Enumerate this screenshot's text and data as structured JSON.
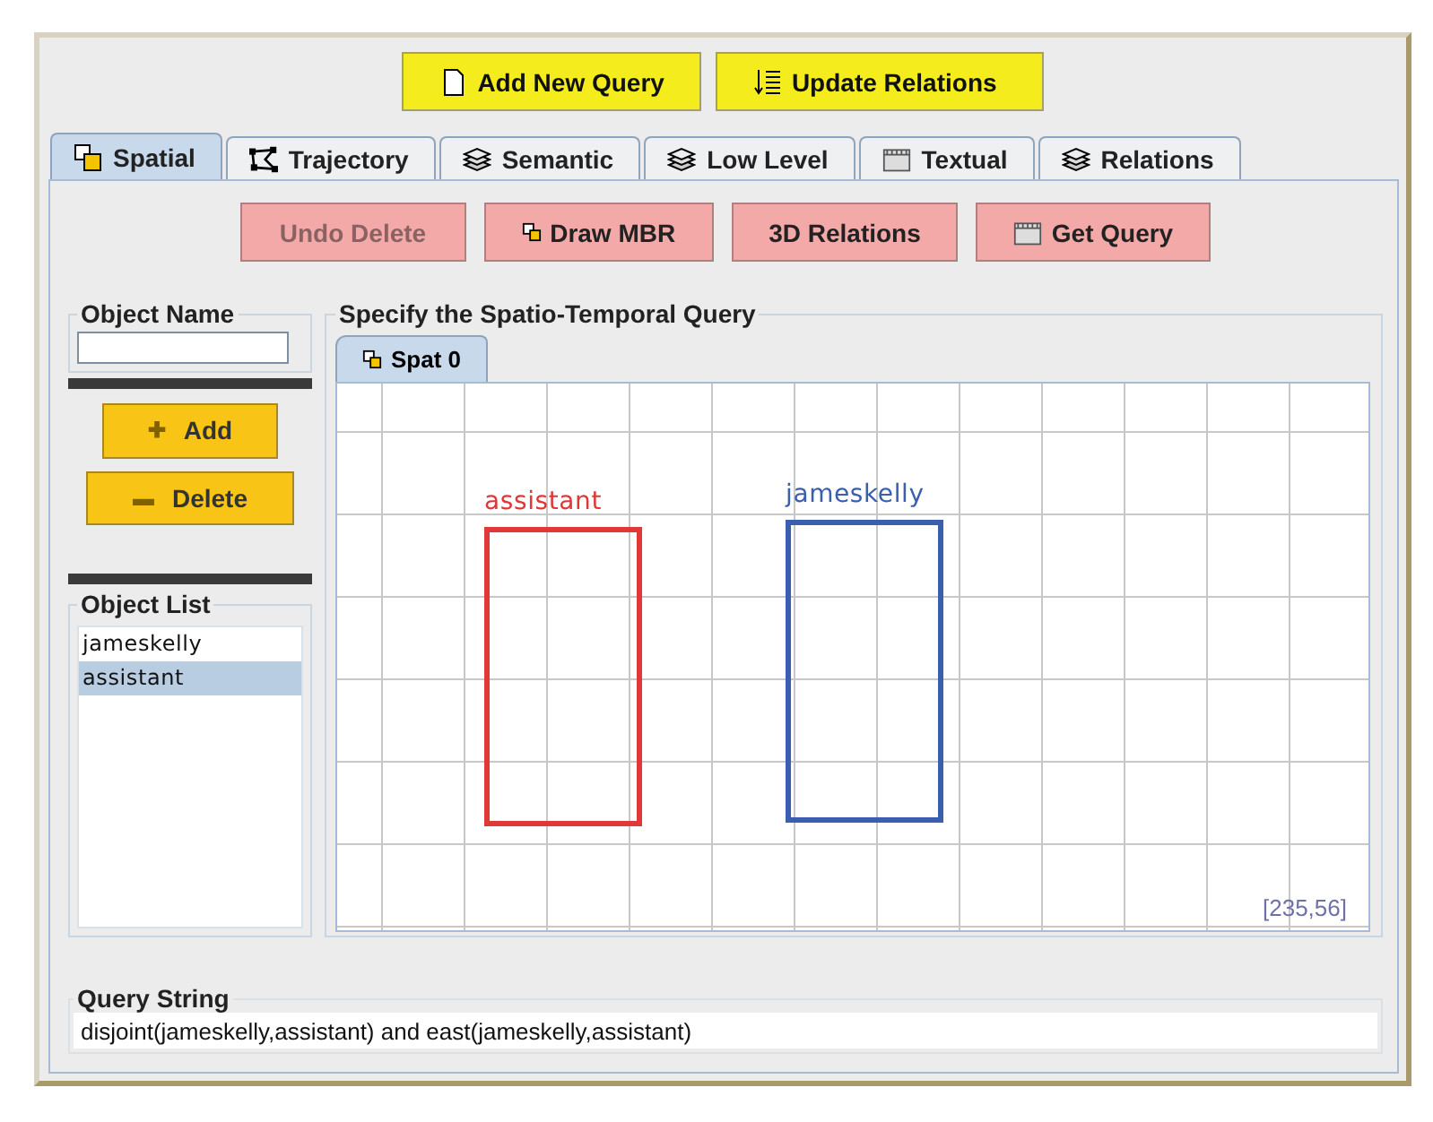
{
  "toolbar": [
    {
      "label": "Add New Query",
      "kind": "page"
    },
    {
      "label": "Update Relations",
      "kind": "sort"
    }
  ],
  "tabs": [
    {
      "label": "Spatial",
      "kind": "squares",
      "selected": true
    },
    {
      "label": "Trajectory",
      "kind": "path",
      "selected": false
    },
    {
      "label": "Semantic",
      "kind": "stack",
      "selected": false
    },
    {
      "label": "Low Level",
      "kind": "stack",
      "selected": false
    },
    {
      "label": "Textual",
      "kind": "film",
      "selected": false
    },
    {
      "label": "Relations",
      "kind": "stack",
      "selected": false
    }
  ],
  "actions": [
    {
      "label": "Undo Delete",
      "disabled": true
    },
    {
      "label": "Draw MBR",
      "kind": "mbr",
      "disabled": false
    },
    {
      "label": "3D Relations",
      "disabled": false
    },
    {
      "label": "Get Query",
      "kind": "film",
      "disabled": false
    }
  ],
  "object_name": {
    "title": "Object Name"
  },
  "add_button": {
    "label": "Add",
    "symbol": "✚"
  },
  "delete_button": {
    "label": "Delete",
    "symbol": "▬"
  },
  "object_list": {
    "title": "Object List",
    "items": [
      {
        "label": "jameskelly",
        "selected": false
      },
      {
        "label": "assistant",
        "selected": true
      }
    ]
  },
  "query_panel": {
    "title": "Specify the Spatio-Temporal Query",
    "tabs": [
      {
        "label": "Spat 0",
        "selected": true
      }
    ],
    "objects": [
      {
        "label": "assistant",
        "color": "#e03838"
      },
      {
        "label": "jameskelly",
        "color": "#3a5fae"
      }
    ],
    "coordinates": "[235,56]"
  },
  "query_string": {
    "title": "Query String",
    "value": "disjoint(jameskelly,assistant) and east(jameskelly,assistant)"
  }
}
